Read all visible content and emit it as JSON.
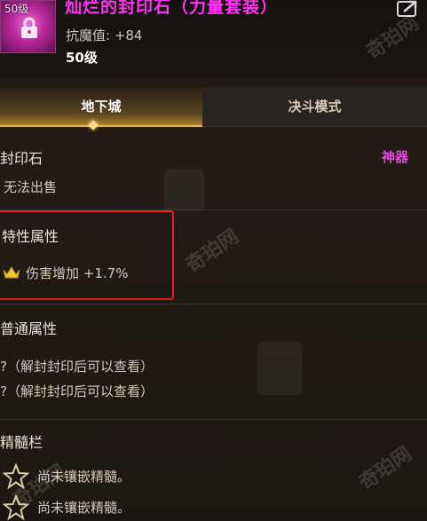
{
  "item": {
    "level_tag": "50级",
    "title": "灿烂的封印石（力量套装）",
    "stat": "抗魔值: +84",
    "level": "50级"
  },
  "tabs": [
    {
      "label": "地下城",
      "active": true
    },
    {
      "label": "决斗模式",
      "active": false
    }
  ],
  "category": {
    "label": "封印石",
    "rarity": "神器",
    "rarity_color": "#e24ad9"
  },
  "trade_status": "无法出售",
  "special_attr": {
    "heading": "特性属性",
    "value": "伤害增加 +1.7%"
  },
  "normal_attr": {
    "heading": "普通属性",
    "lines": [
      "?（解封封印后可以查看）",
      "?（解封封印后可以查看）"
    ]
  },
  "gem_slots": {
    "heading": "精髓栏",
    "items": [
      "尚未镶嵌精髓。",
      "尚未镶嵌精髓。"
    ]
  },
  "watermark": "奇珀网",
  "colors": {
    "accent_gold": "#e1b352",
    "title_magenta": "#ff34f1",
    "highlight_red": "#e8201b"
  }
}
